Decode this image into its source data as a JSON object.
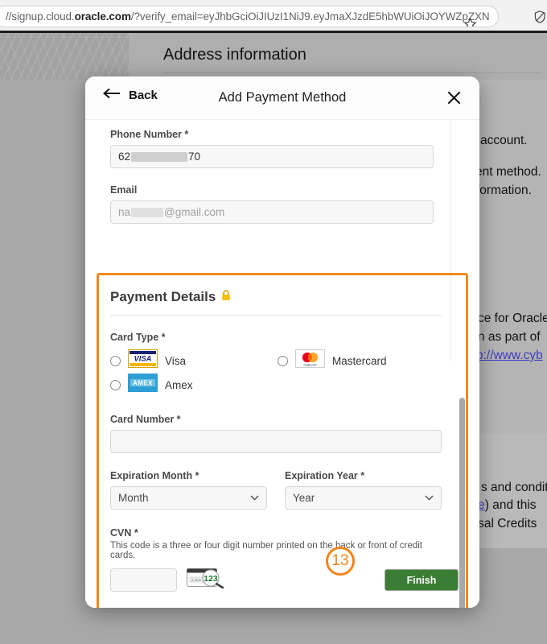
{
  "browser": {
    "url_prefix": "//signup.cloud.",
    "url_domain": "oracle.com",
    "url_suffix": "/?verify_email=eyJhbGciOiJIUzI1NiJ9.eyJmaXJzdE5hbWUiOiJOYWZpZXN",
    "star_icon": "bookmark-star-icon",
    "shield_icon": "shield-icon"
  },
  "background": {
    "heading": "Address information",
    "lines": [
      "account.",
      "ent method.",
      "formation.",
      "ce for Oracle",
      "n as part of",
      "p://www.cyb",
      "s and condit",
      "re",
      ") and this ",
      "rsal Credits"
    ]
  },
  "modal": {
    "back_label": "Back",
    "back_icon": "arrow-left-icon",
    "title": "Add Payment Method",
    "close_icon": "close-icon",
    "fields": {
      "phone_label": "Phone Number *",
      "phone_value_start": "62",
      "phone_value_end": "70",
      "email_label": "Email",
      "email_placeholder_start": "na",
      "email_placeholder_end": "@gmail.com"
    },
    "payment": {
      "heading": "Payment Details",
      "lock_icon": "padlock-icon",
      "card_type_label": "Card Type *",
      "card_types": [
        {
          "id": "visa",
          "label": "Visa",
          "logo": "visa-logo",
          "selected": false
        },
        {
          "id": "mastercard",
          "label": "Mastercard",
          "logo": "mastercard-logo",
          "selected": false
        },
        {
          "id": "amex",
          "label": "Amex",
          "logo": "amex-logo",
          "selected": false
        }
      ],
      "card_number_label": "Card Number *",
      "card_number_value": "",
      "expiration_month_label": "Expiration Month *",
      "expiration_month_value": "Month",
      "expiration_year_label": "Expiration Year *",
      "expiration_year_value": "Year",
      "cvn_label": "CVN *",
      "cvn_help": "This code is a three or four digit number printed on the back or front of credit cards.",
      "cvn_value": "",
      "cvn_icon": "card-cvn-magnifier-icon",
      "cvn_icon_digits": "123"
    },
    "finish_label": "Finish",
    "step_badge": "13"
  },
  "colors": {
    "accent_orange": "#f2861a",
    "finish_green": "#3b7d34",
    "lock_yellow": "#f2c200",
    "link_blue": "#3b3bbf"
  }
}
